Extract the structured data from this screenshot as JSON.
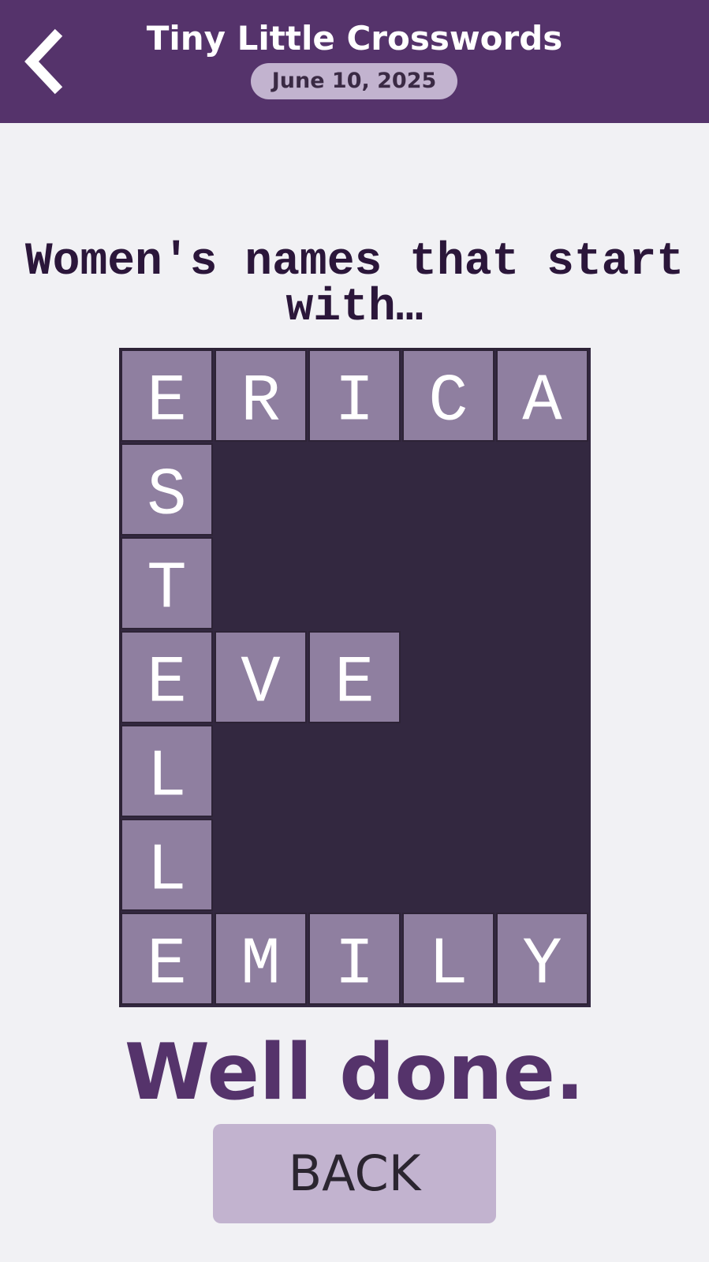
{
  "header": {
    "title": "Tiny Little Crosswords",
    "date": "June 10, 2025",
    "back_icon": "chevron-left-icon"
  },
  "puzzle": {
    "clue": "Women's names that start with…",
    "rows": 7,
    "cols": 5,
    "grid": [
      [
        "E",
        "R",
        "I",
        "C",
        "A"
      ],
      [
        "S",
        null,
        null,
        null,
        null
      ],
      [
        "T",
        null,
        null,
        null,
        null
      ],
      [
        "E",
        "V",
        "E",
        null,
        null
      ],
      [
        "L",
        null,
        null,
        null,
        null
      ],
      [
        "L",
        null,
        null,
        null,
        null
      ],
      [
        "E",
        "M",
        "I",
        "L",
        "Y"
      ]
    ],
    "answers": [
      "ERICA",
      "ESTELLE",
      "EVE",
      "EMILY"
    ]
  },
  "status": {
    "message": "Well done."
  },
  "actions": {
    "back_label": "BACK"
  },
  "colors": {
    "primary": "#55336b",
    "accent_light": "#c2b3cf",
    "cell_filled": "#8f7fa0",
    "cell_blocked": "#332840",
    "background": "#f1f1f4"
  }
}
